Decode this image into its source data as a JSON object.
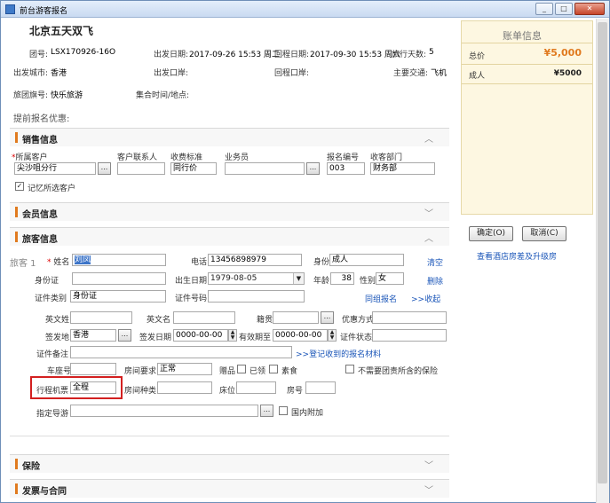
{
  "window": {
    "title": "前台游客报名",
    "controls": {
      "minimize": "_",
      "maximize": "□",
      "close": "✕"
    }
  },
  "tour": {
    "title": "北京五天双飞",
    "group_no_label": "团号:",
    "group_no": "LSX170926-16O",
    "depart_date_label": "出发日期:",
    "depart_date": "2017-09-26 15:53 周二",
    "return_date_label": "回程日期:",
    "return_date": "2017-09-30 15:53 周六",
    "days_label": "旅行天数:",
    "days": "5",
    "depart_city_label": "出发城市:",
    "depart_city": "香港",
    "depart_port_label": "出发口岸:",
    "depart_port": "",
    "return_port_label": "回程口岸:",
    "return_port": "",
    "transport_label": "主要交通:",
    "transport": "飞机",
    "brand_label": "旅团旗号:",
    "brand": "快乐旅游",
    "gather_label": "集合时间/地点:",
    "gather": "",
    "early_discount_label": "提前报名优惠:"
  },
  "sections": {
    "sales": "销售信息",
    "member": "会员信息",
    "traveler": "旅客信息",
    "insurance": "保险",
    "invoice": "发票与合同"
  },
  "icons": {
    "collapse": "chevron-up-icon",
    "expand": "chevron-down-icon"
  },
  "sales": {
    "client_label": "所属客户",
    "client": "尖沙咀分行",
    "contact_label": "客户联系人",
    "contact": "",
    "fee_label": "收费标准",
    "fee": "同行价",
    "staff_label": "业务员",
    "staff": "",
    "report_no_label": "报名编号",
    "report_no": "003",
    "dept_label": "收客部门",
    "dept": "财务部",
    "remember_label": "记忆所选客户",
    "remember_checked": true
  },
  "traveler": {
    "index_label": "旅客 1",
    "name_label": "姓名",
    "name": "刘凤",
    "phone_label": "电话",
    "phone": "13456898979",
    "identity_label": "身份",
    "identity": "成人",
    "clear_link": "清空",
    "id_card_label": "身份证",
    "id_card": "",
    "birth_label": "出生日期",
    "birth": "1979-08-05",
    "age_label": "年龄",
    "age": "38",
    "gender_label": "性别",
    "gender": "女",
    "delete_link": "删除",
    "cert_type_label": "证件类别",
    "cert_type": "身份证",
    "cert_no_label": "证件号码",
    "cert_no": "",
    "same_group_link": "同组报名",
    "collapse_link": ">>收起",
    "en_last_label": "英文姓",
    "en_last": "",
    "en_first_label": "英文名",
    "en_first": "",
    "native_label": "籍贯",
    "native": "",
    "contact_pref_label": "优惠方式",
    "contact_pref": "",
    "issue_place_label": "签发地",
    "issue_place": "香港",
    "issue_date_label": "签发日期",
    "issue_date": "0000-00-00",
    "valid_until_label": "有效期至",
    "valid_until": "0000-00-00",
    "cert_status_label": "证件状态",
    "cert_status": "",
    "cert_note_label": "证件备注",
    "cert_note": "",
    "register_link": ">>登记收到的报名材料",
    "seat_label": "车座号",
    "seat": "",
    "room_req_label": "房间要求",
    "room_req": "正常",
    "gift_label": "赠品",
    "gift_received_label": "已领",
    "vegetarian_label": "素食",
    "no_insurance_label": "不需要团责所含的保险",
    "ticket_label": "行程机票",
    "ticket": "全程",
    "room_type_label": "房间种类",
    "room_type": "",
    "bed_label": "床位",
    "bed": "",
    "room_no_label": "房号",
    "room_no": "",
    "guide_label": "指定导游",
    "guide": "",
    "domestic_label": "国内附加"
  },
  "account": {
    "title": "账单信息",
    "total_label": "总价",
    "total": "¥5,000",
    "adult_label": "成人",
    "adult": "¥5000"
  },
  "buttons": {
    "confirm": "确定(O)",
    "cancel": "取消(C)"
  },
  "hotel_link": "查看酒店房差及升级房",
  "colors": {
    "accent": "#e07a1f",
    "price": "#e07a1f",
    "link": "#1a55b8",
    "highlight": "#d32020"
  }
}
